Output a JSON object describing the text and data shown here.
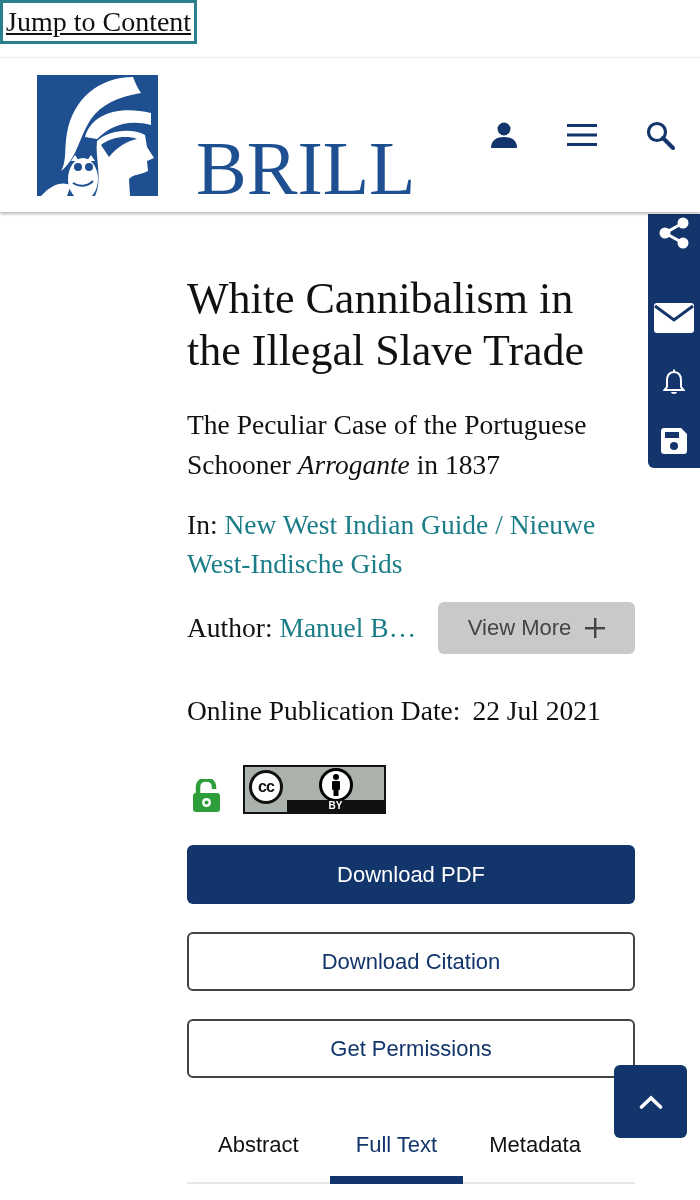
{
  "skip_link": "Jump to Content",
  "header": {
    "logo_text": "BRILL"
  },
  "article": {
    "title": "White Cannibalism in the Illegal Slave Trade",
    "subtitle": "The Peculiar Case of the Portuguese Schooner *Arrogante* in 1837",
    "source_label": "In:",
    "source": "New West Indian Guide / Nieuwe West-Indische Gids",
    "author_label": "Author:",
    "author": "Manuel B…",
    "view_more": "View More",
    "date_label": "Online Publication Date:",
    "date": "22 Jul 2021",
    "open_access": true,
    "license": {
      "symbol": "cc",
      "label": "BY"
    }
  },
  "actions": [
    {
      "label": "Download PDF",
      "kind": "primary"
    },
    {
      "label": "Download Citation",
      "kind": "outline"
    },
    {
      "label": "Get Permissions",
      "kind": "outline"
    }
  ],
  "tabs": [
    {
      "label": "Abstract",
      "selected": false
    },
    {
      "label": "Full Text",
      "selected": true
    },
    {
      "label": "Metadata",
      "selected": false
    }
  ]
}
